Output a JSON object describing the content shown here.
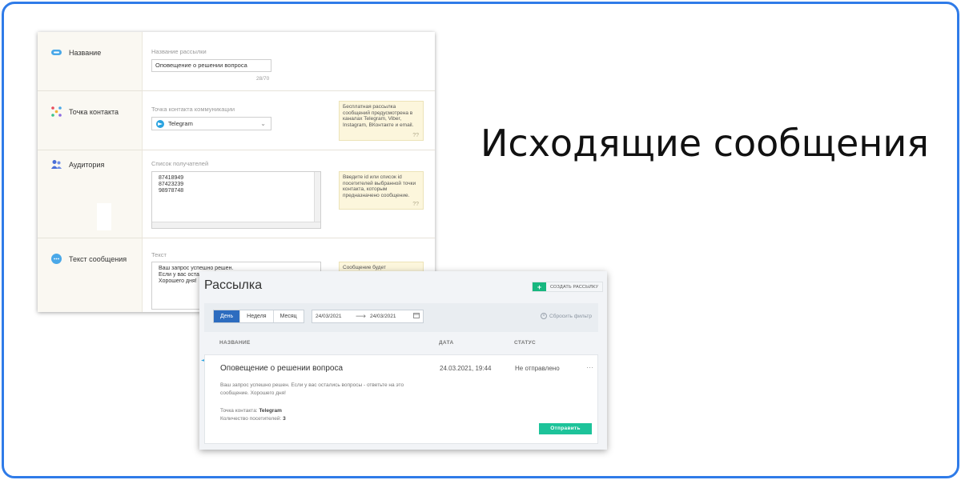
{
  "headline": "Исходящие сообщения",
  "form": {
    "rows": {
      "name": {
        "label": "Название",
        "caption": "Название рассылки",
        "value": "Оповещение о решении вопроса",
        "counter": "28/70"
      },
      "contact": {
        "label": "Точка контакта",
        "caption": "Точка контакта коммуникации",
        "value": "Telegram",
        "hint": "Бесплатная рассылка сообщений предусмотрена в каналах Telegram, Viber, Instagram, ВКонтакте и email.",
        "hint_q": "??"
      },
      "audience": {
        "label": "Аудитория",
        "caption": "Список получателей",
        "lines": [
          "87418949",
          "87423239",
          "98978748"
        ],
        "hint": "Введите id или список id посетителей выбранной точки контакта, которым предназначено сообщение.",
        "hint_q": "??"
      },
      "message": {
        "label": "Текст сообщения",
        "caption": "Текст",
        "lines": [
          "Ваш запрос успешно решен.",
          "Если у вас оста",
          "Хорошего дня!"
        ],
        "hint": "Сообщение будет"
      }
    }
  },
  "mailing": {
    "title": "Рассылка",
    "create_button": "СОЗДАТЬ РАССЫЛКУ",
    "period_tabs": [
      "День",
      "Неделя",
      "Месяц"
    ],
    "active_tab": "День",
    "date_from": "24/03/2021",
    "date_to": "24/03/2021",
    "reset_filter": "Сбросить фильтр",
    "columns": {
      "name": "НАЗВАНИЕ",
      "date": "ДАТА",
      "status": "СТАТУС"
    },
    "item": {
      "title": "Оповещение о решении вопроса",
      "date": "24.03.2021, 19:44",
      "status": "Не отправлено",
      "more": "···",
      "body_line1": "Ваш запрос успешно решен. Если у вас остались вопросы - ответьте на это",
      "body_line2": "сообщение. Хорошего дня!",
      "contact_label": "Точка контакта:",
      "contact_value": "Telegram",
      "visitors_label": "Количество посетителей:",
      "visitors_value": "3",
      "send_button": "Отправить"
    }
  },
  "colors": {
    "frame_border": "#2f7be8",
    "active_tab": "#2d6cbf",
    "send_button": "#1dc39a",
    "create_plus": "#17b77f",
    "hint_bg": "#fcf6dc"
  }
}
